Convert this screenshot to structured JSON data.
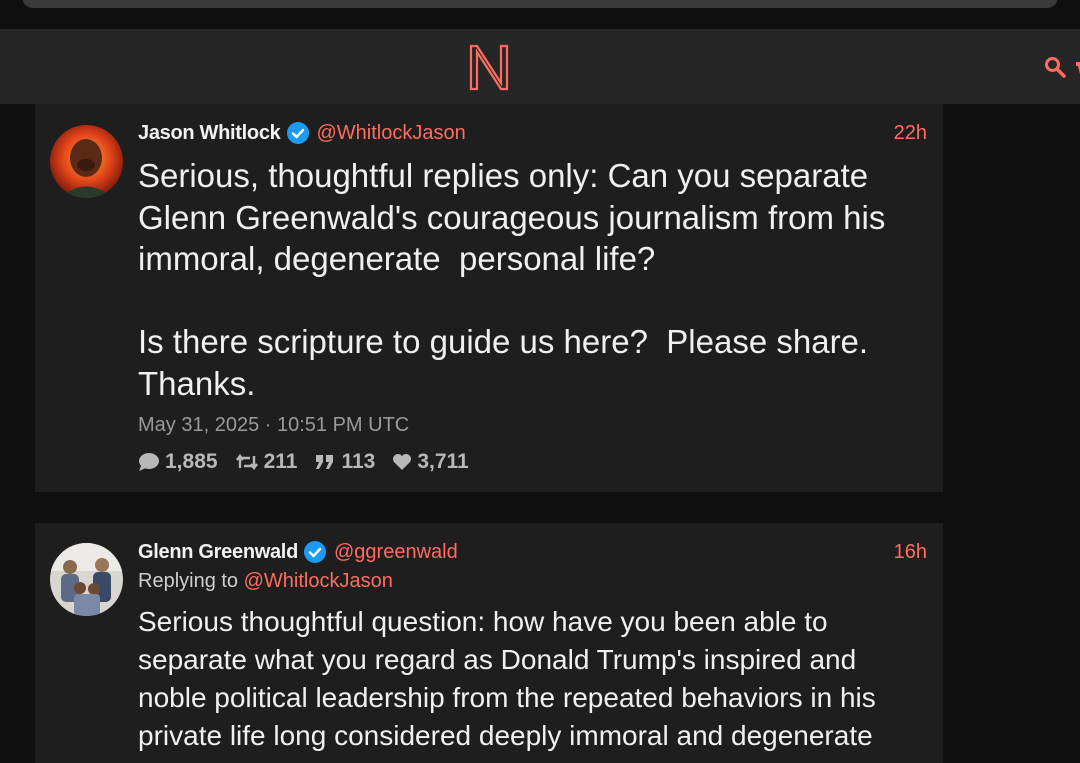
{
  "colors": {
    "accent": "#ff6c60",
    "verified": "#1d9bf0",
    "background": "#0f0f0f",
    "card": "#1e1e1f",
    "navbar": "#262626"
  },
  "navbar": {
    "logo_icon": "nitter-logo-icon",
    "search_icon": "search-icon"
  },
  "tweets": [
    {
      "fullname": "Jason Whitlock",
      "handle": "@WhitlockJason",
      "time": "22h",
      "text": "Serious, thoughtful replies only: Can you separate Glenn Greenwald's courageous journalism from his immoral, degenerate  personal life?\n\nIs there scripture to guide us here?  Please share. Thanks.",
      "date": "May 31, 2025 · 10:51 PM UTC",
      "stats": {
        "replies": "1,885",
        "retweets": "211",
        "quotes": "113",
        "likes": "3,711"
      }
    },
    {
      "fullname": "Glenn Greenwald",
      "handle": "@ggreenwald",
      "time": "16h",
      "replying_label": "Replying to",
      "replying_handle": "@WhitlockJason",
      "text": "Serious thoughtful question: how have you been able to separate what you regard as Donald Trump's inspired and noble political leadership from the repeated behaviors in his private life long considered deeply immoral and degenerate"
    }
  ]
}
